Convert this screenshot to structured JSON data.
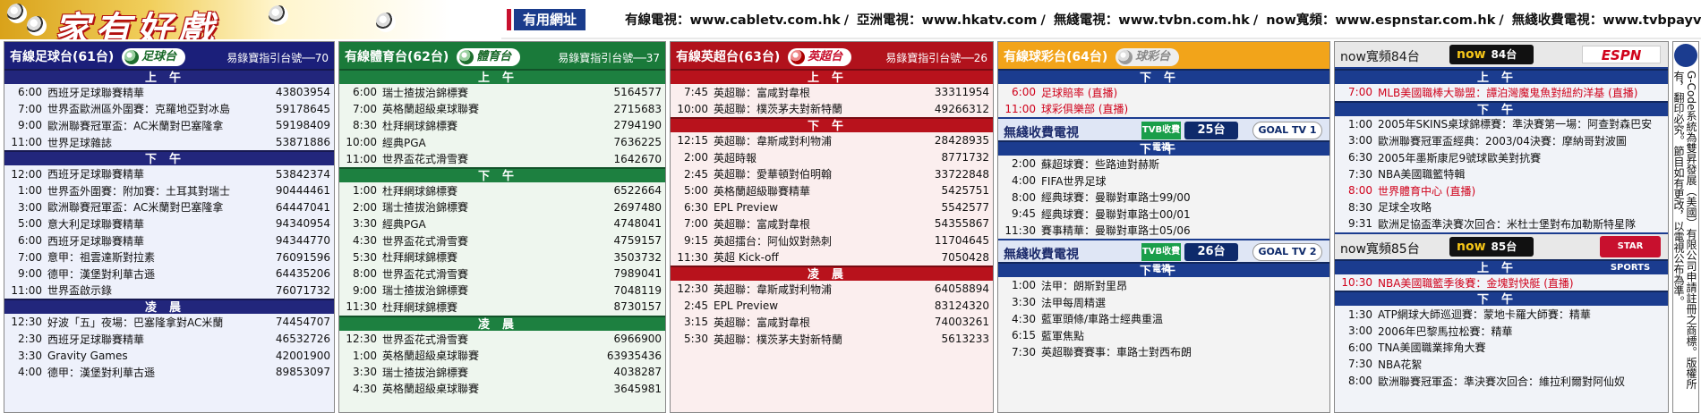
{
  "banner": {
    "title": "家有好戲",
    "useful_label": "有用網址",
    "urls": [
      "有線電視：www.cabletv.com.hk",
      "亞洲電視：www.hkatv.com",
      "無綫電視：www.tvbn.com.hk",
      "now寬頻：www.espnstar.com.hk",
      "無綫收費電視：www.tvbpayvision.com"
    ]
  },
  "col1": {
    "name": "有線足球台(61台)",
    "logo": "足球台",
    "guide": "易錄寶指引台號──70",
    "sections": [
      {
        "label": "上午",
        "rows": [
          {
            "time": "6:00",
            "prog": "西班牙足球聯賽精華",
            "code": "43803954"
          },
          {
            "time": "7:00",
            "prog": "世界盃歐洲區外圍賽：克羅地亞對冰島",
            "code": "59178645"
          },
          {
            "time": "9:00",
            "prog": "歐洲聯賽冠軍盃：AC米蘭對巴塞隆拿",
            "code": "59198409"
          },
          {
            "time": "11:00",
            "prog": "世界足球雜誌",
            "code": "53871886"
          }
        ]
      },
      {
        "label": "下午",
        "rows": [
          {
            "time": "12:00",
            "prog": "西班牙足球聯賽精華",
            "code": "53842374"
          },
          {
            "time": "1:00",
            "prog": "世界盃外圍賽：附加賽：土耳其對瑞士",
            "code": "90444461"
          },
          {
            "time": "3:00",
            "prog": "歐洲聯賽冠軍盃：AC米蘭對巴塞隆拿",
            "code": "64447041"
          },
          {
            "time": "5:00",
            "prog": "意大利足球聯賽精華",
            "code": "94340954"
          },
          {
            "time": "6:00",
            "prog": "西班牙足球聯賽精華",
            "code": "94344770"
          },
          {
            "time": "7:00",
            "prog": "意甲：祖雲達斯對拉素",
            "code": "76091596"
          },
          {
            "time": "9:00",
            "prog": "德甲：漢堡對利華古遜",
            "code": "64435206"
          },
          {
            "time": "11:00",
            "prog": "世界盃啟示錄",
            "code": "76071732"
          }
        ]
      },
      {
        "label": "凌晨",
        "rows": [
          {
            "time": "12:30",
            "prog": "好波「五」夜場：巴塞隆拿對AC米蘭",
            "code": "74454707"
          },
          {
            "time": "2:30",
            "prog": "西班牙足球聯賽精華",
            "code": "46532726"
          },
          {
            "time": "3:30",
            "prog": "Gravity Games",
            "code": "42001900"
          },
          {
            "time": "4:00",
            "prog": "德甲：漢堡對利華古遜",
            "code": "89853097"
          }
        ]
      }
    ]
  },
  "col2": {
    "name": "有線體育台(62台)",
    "logo": "體育台",
    "guide": "易錄寶指引台號──37",
    "sections": [
      {
        "label": "上午",
        "rows": [
          {
            "time": "6:00",
            "prog": "瑞士揸拔治錦標賽",
            "code": "5164577"
          },
          {
            "time": "7:00",
            "prog": "英格蘭超級桌球聯賽",
            "code": "2715683"
          },
          {
            "time": "8:30",
            "prog": "杜拜網球錦標賽",
            "code": "2794190"
          },
          {
            "time": "10:00",
            "prog": "經典PGA",
            "code": "7636225"
          },
          {
            "time": "11:00",
            "prog": "世界盃花式滑雪賽",
            "code": "1642670"
          }
        ]
      },
      {
        "label": "下午",
        "rows": [
          {
            "time": "1:00",
            "prog": "杜拜網球錦標賽",
            "code": "6522664"
          },
          {
            "time": "2:00",
            "prog": "瑞士揸拔治錦標賽",
            "code": "2697480"
          },
          {
            "time": "3:30",
            "prog": "經典PGA",
            "code": "4748041"
          },
          {
            "time": "4:30",
            "prog": "世界盃花式滑雪賽",
            "code": "4759157"
          },
          {
            "time": "5:30",
            "prog": "杜拜網球錦標賽",
            "code": "3503732"
          },
          {
            "time": "8:00",
            "prog": "世界盃花式滑雪賽",
            "code": "7989041"
          },
          {
            "time": "9:00",
            "prog": "瑞士揸拔治錦標賽",
            "code": "7048119"
          },
          {
            "time": "11:30",
            "prog": "杜拜網球錦標賽",
            "code": "8730157"
          }
        ]
      },
      {
        "label": "凌晨",
        "rows": [
          {
            "time": "12:30",
            "prog": "世界盃花式滑雪賽",
            "code": "6966900"
          },
          {
            "time": "1:00",
            "prog": "英格蘭超級桌球聯賽",
            "code": "63935436"
          },
          {
            "time": "3:30",
            "prog": "瑞士揸拔治錦標賽",
            "code": "4038287"
          },
          {
            "time": "4:30",
            "prog": "英格蘭超級桌球聯賽",
            "code": "3645981"
          }
        ]
      }
    ]
  },
  "col3": {
    "name": "有線英超台(63台)",
    "logo": "英超台",
    "guide": "易錄寶指引台號──26",
    "sections": [
      {
        "label": "上午",
        "rows": [
          {
            "time": "7:45",
            "prog": "英超聯：富咸對韋根",
            "code": "33311954"
          },
          {
            "time": "10:00",
            "prog": "英超聯：樸茨茅夫對新特蘭",
            "code": "49266312"
          }
        ]
      },
      {
        "label": "下午",
        "rows": [
          {
            "time": "12:15",
            "prog": "英超聯：韋斯咸對利物浦",
            "code": "28428935"
          },
          {
            "time": "2:00",
            "prog": "英超時報",
            "code": "8771732"
          },
          {
            "time": "2:45",
            "prog": "英超聯：愛華頓對伯明翰",
            "code": "33722848"
          },
          {
            "time": "5:00",
            "prog": "英格蘭超級聯賽精華",
            "code": "5425751"
          },
          {
            "time": "6:30",
            "prog": "EPL Preview",
            "code": "5542577"
          },
          {
            "time": "7:00",
            "prog": "英超聯：富咸對韋根",
            "code": "54355867"
          },
          {
            "time": "9:15",
            "prog": "英超擂台：阿仙奴對熱刺",
            "code": "11704645"
          },
          {
            "time": "11:30",
            "prog": "英超 Kick-off",
            "code": "7050428"
          }
        ]
      },
      {
        "label": "凌晨",
        "rows": [
          {
            "time": "12:30",
            "prog": "英超聯：韋斯咸對利物浦",
            "code": "64058894"
          },
          {
            "time": "2:45",
            "prog": "EPL Preview",
            "code": "83124320"
          },
          {
            "time": "3:15",
            "prog": "英超聯：富咸對韋根",
            "code": "74003261"
          },
          {
            "time": "5:30",
            "prog": "英超聯：樸茨茅夫對新特蘭",
            "code": "5613233"
          }
        ]
      }
    ]
  },
  "col4": {
    "name": "有線球彩台(64台)",
    "logo": "球彩台",
    "section_top": {
      "label": "下午",
      "rows": [
        {
          "time": "6:00",
          "prog": "足球賠率 (直播)",
          "hl": true
        },
        {
          "time": "11:00",
          "prog": "球彩俱樂部 (直播)",
          "hl": true
        }
      ]
    },
    "sub1": {
      "name": "無綫收費電視",
      "tvb": "TVB收費電視",
      "channel": "25台",
      "goal": "GOAL TV 1"
    },
    "sub1_section": {
      "label": "下午",
      "rows": [
        {
          "time": "2:00",
          "prog": "蘇超球賽：些路迪對赫斯"
        },
        {
          "time": "4:00",
          "prog": "FIFA世界足球"
        },
        {
          "time": "8:00",
          "prog": "經典球賽：曼聯對車路士99/00"
        },
        {
          "time": "9:45",
          "prog": "經典球賽：曼聯對車路士00/01"
        },
        {
          "time": "11:30",
          "prog": "賽事精華：曼聯對車路士05/06"
        }
      ]
    },
    "sub2": {
      "name": "無綫收費電視",
      "tvb": "TVB收費電視",
      "channel": "26台",
      "goal": "GOAL TV 2"
    },
    "sub2_section": {
      "label": "下午",
      "rows": [
        {
          "time": "1:00",
          "prog": "法甲：朗斯對里昂"
        },
        {
          "time": "3:30",
          "prog": "法甲每周精選"
        },
        {
          "time": "4:30",
          "prog": "藍軍頭條/車路士經典重溫"
        },
        {
          "time": "6:15",
          "prog": "藍軍焦點"
        },
        {
          "time": "7:30",
          "prog": "英超聯賽賽事：車路士對西布朗"
        }
      ]
    }
  },
  "col5": {
    "name": "now寬頻84台",
    "now_logo": "now",
    "now_channel": "84台",
    "espn": "ESPN",
    "sections": [
      {
        "label": "上午",
        "rows": [
          {
            "time": "7:00",
            "prog": "MLB美國職棒大聯盟：譚泊灣魔鬼魚對紐約洋基 (直播)",
            "hl": true
          }
        ]
      },
      {
        "label": "下午",
        "rows": [
          {
            "time": "1:00",
            "prog": "2005年SKINS桌球錦標賽：準決賽第一場：阿查對森巴安"
          },
          {
            "time": "3:00",
            "prog": "歐洲聯賽冠軍盃經典：2003/04決賽：摩納哥對波圖"
          },
          {
            "time": "6:30",
            "prog": "2005年墨斯康尼9號球歐美對抗賽"
          },
          {
            "time": "7:30",
            "prog": "NBA美國職籃特輯"
          },
          {
            "time": "8:00",
            "prog": "世界體育中心 (直播)",
            "hl": true
          },
          {
            "time": "8:30",
            "prog": "足球全攻略"
          },
          {
            "time": "9:31",
            "prog": "歐洲足協盃準決賽次回合：米杜士堡對布加勒斯特星隊"
          }
        ]
      }
    ],
    "sub_name": "now寬頻85台",
    "sub_now_channel": "85台",
    "starsports": "STAR SPORTS",
    "sub_sections": [
      {
        "label": "上午",
        "rows": [
          {
            "time": "10:30",
            "prog": "NBA美國職籃季後賽：金塊對快艇 (直播)",
            "hl": true
          }
        ]
      },
      {
        "label": "下午",
        "rows": [
          {
            "time": "1:30",
            "prog": "ATP網球大師巡迴賽：蒙地卡羅大師賽：精華"
          },
          {
            "time": "3:00",
            "prog": "2006年巴黎馬拉松賽：精華"
          },
          {
            "time": "6:00",
            "prog": "TNA美國職業摔角大賽"
          },
          {
            "time": "7:30",
            "prog": "NBA花絮"
          },
          {
            "time": "8:00",
            "prog": "歐洲聯賽冠軍盃：準決賽次回合：維拉利爾對阿仙奴"
          }
        ]
      }
    ]
  },
  "side_note": "G-Code系統為雙昇發展（美國）有限公司申請註冊之商標。版權所有，翻印必究。節目如有更改，以電視公布為準。"
}
